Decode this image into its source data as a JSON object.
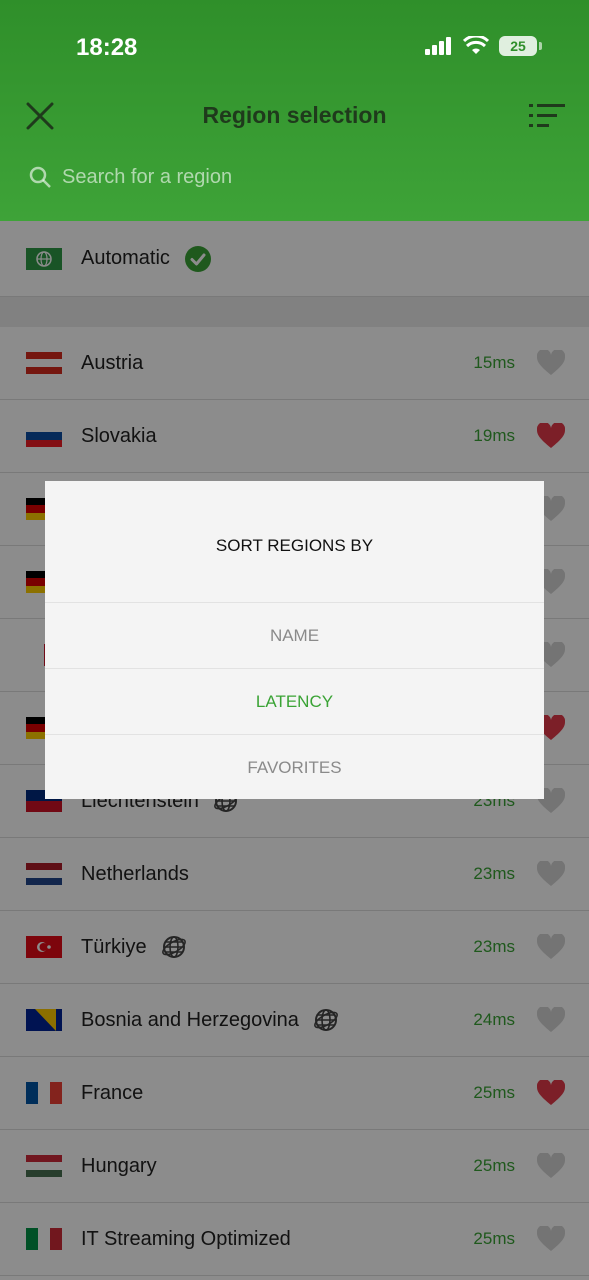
{
  "status": {
    "time": "18:28",
    "battery": "25"
  },
  "header": {
    "title": "Region selection",
    "search_placeholder": "Search for a region"
  },
  "automatic": {
    "label": "Automatic"
  },
  "regions": [
    {
      "name": "Austria",
      "latency": "15ms",
      "favorite": false
    },
    {
      "name": "Slovakia",
      "latency": "19ms",
      "favorite": true
    },
    {
      "name": "",
      "latency": "",
      "favorite": false
    },
    {
      "name": "",
      "latency": "",
      "favorite": false
    },
    {
      "name": "",
      "latency": "",
      "favorite": false
    },
    {
      "name": "",
      "latency": "",
      "favorite": true
    },
    {
      "name": "Liechtenstein",
      "latency": "23ms",
      "favorite": false,
      "virtual": true
    },
    {
      "name": "Netherlands",
      "latency": "23ms",
      "favorite": false
    },
    {
      "name": "Türkiye",
      "latency": "23ms",
      "favorite": false,
      "virtual": true
    },
    {
      "name": "Bosnia and Herzegovina",
      "latency": "24ms",
      "favorite": false,
      "virtual": true
    },
    {
      "name": "France",
      "latency": "25ms",
      "favorite": true
    },
    {
      "name": "Hungary",
      "latency": "25ms",
      "favorite": false
    },
    {
      "name": "IT Streaming Optimized",
      "latency": "25ms",
      "favorite": false
    }
  ],
  "sort_dialog": {
    "title": "SORT REGIONS BY",
    "options": [
      "NAME",
      "LATENCY",
      "FAVORITES"
    ],
    "selected": "LATENCY"
  },
  "colors": {
    "accent": "#3aa335",
    "favorite": "#e23a4a",
    "heart_off": "#d3d3d3"
  }
}
